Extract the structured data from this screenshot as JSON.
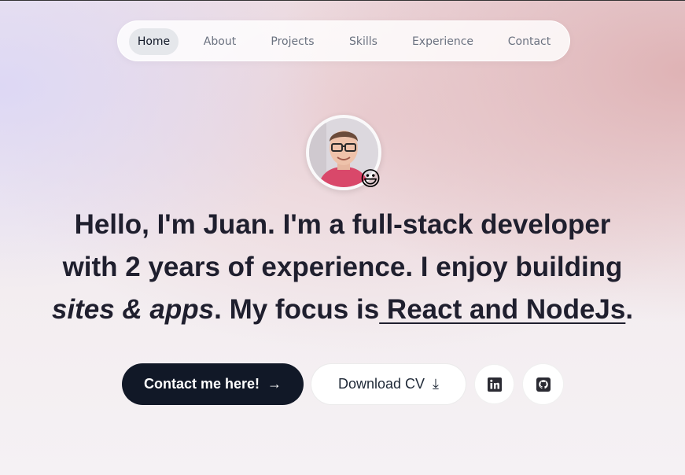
{
  "nav": {
    "items": [
      {
        "label": "Home",
        "active": true
      },
      {
        "label": "About",
        "active": false
      },
      {
        "label": "Projects",
        "active": false
      },
      {
        "label": "Skills",
        "active": false
      },
      {
        "label": "Experience",
        "active": false
      },
      {
        "label": "Contact",
        "active": false
      }
    ]
  },
  "hero": {
    "avatar_emoji": "😃",
    "headline": {
      "greeting": "Hello, I'm Juan.",
      "im_a": " I'm a ",
      "role": "full-stack developer",
      "with": "with ",
      "years": "2 years",
      "experience": " of experience. I enjoy building",
      "sites": "sites & apps",
      "focus": ". My focus is",
      "stack": " React and NodeJs",
      "period": "."
    }
  },
  "actions": {
    "contact_label": "Contact me here!",
    "contact_icon": "→",
    "cv_label": "Download CV",
    "cv_icon": "⤓",
    "linkedin_icon": "linkedin-icon",
    "github_icon": "github-icon"
  },
  "colors": {
    "primary_button": "#111827",
    "text": "#1f1f2e",
    "nav_active_bg": "#e5e7eb"
  }
}
